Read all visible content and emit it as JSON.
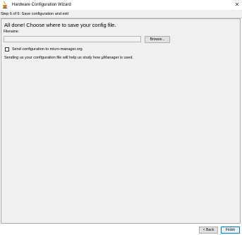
{
  "window": {
    "title": "Hardware Configuration Wizard",
    "app_icon": "java-coffee-cup-icon",
    "close_glyph": "✕"
  },
  "step": {
    "text": "Step 6 of 6: Save configuration and exit"
  },
  "main": {
    "heading": "All done! Choose where to save your config file.",
    "filename_label": "Filename:",
    "filename_value": "",
    "browse_label": "Browse...",
    "send_checkbox_label": "Send configuration to micro-manager.org",
    "send_checked": false,
    "info_text": "Sending us your configuration file will help us study how µManager is used."
  },
  "footer": {
    "back_label": "< Back",
    "finish_label": "Finish"
  },
  "colors": {
    "panel_bg": "#f0f0f0",
    "accent": "#0078d7"
  }
}
